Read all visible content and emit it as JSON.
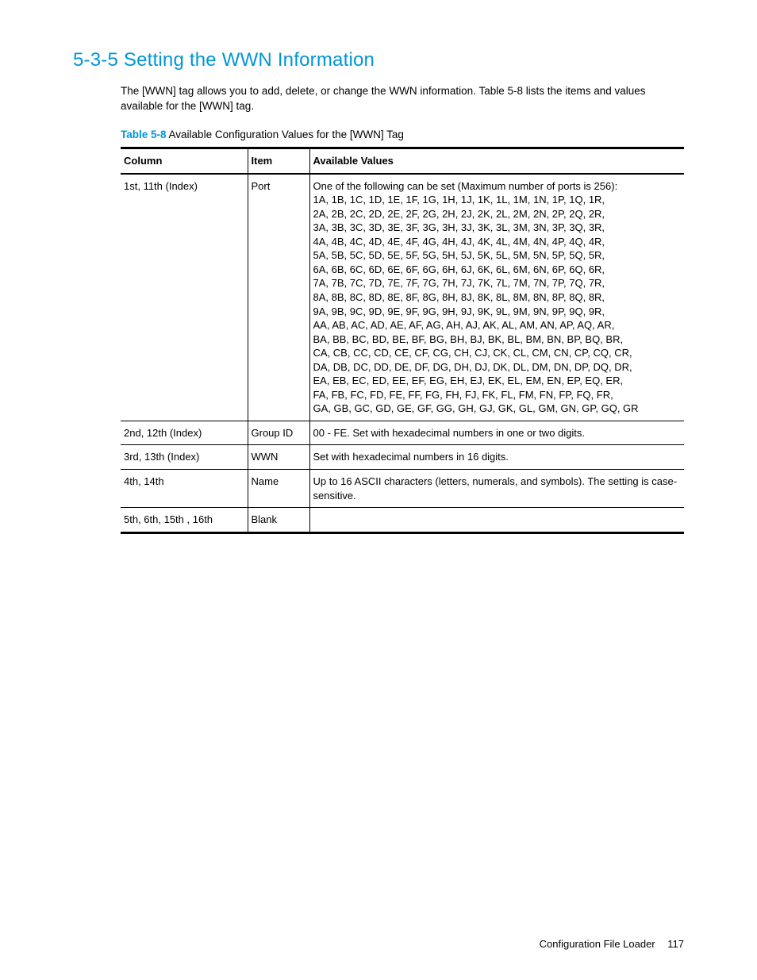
{
  "heading": "5-3-5 Setting the WWN Information",
  "intro": "The [WWN] tag allows you to add, delete, or change the WWN information. Table 5-8 lists the items and values available for the [WWN] tag.",
  "caption": {
    "label": "Table 5-8",
    "title": "  Available Configuration Values for the [WWN] Tag"
  },
  "headers": {
    "c1": "Column",
    "c2": "Item",
    "c3": "Available Values"
  },
  "rows": [
    {
      "column": "1st, 11th (Index)",
      "item": "Port",
      "values": "One of the following can be set (Maximum number of ports is 256):\n1A, 1B, 1C, 1D, 1E, 1F, 1G, 1H, 1J, 1K, 1L, 1M, 1N, 1P, 1Q, 1R,\n2A, 2B, 2C, 2D, 2E, 2F, 2G, 2H, 2J, 2K, 2L, 2M, 2N, 2P, 2Q, 2R,\n3A, 3B, 3C, 3D, 3E, 3F, 3G, 3H, 3J, 3K, 3L, 3M, 3N, 3P, 3Q, 3R,\n4A, 4B, 4C, 4D, 4E, 4F, 4G, 4H, 4J, 4K, 4L, 4M, 4N, 4P, 4Q, 4R,\n5A, 5B, 5C, 5D, 5E, 5F, 5G, 5H, 5J, 5K, 5L, 5M, 5N, 5P, 5Q, 5R,\n6A, 6B, 6C, 6D, 6E, 6F, 6G, 6H, 6J, 6K, 6L, 6M, 6N, 6P, 6Q, 6R,\n7A, 7B, 7C, 7D, 7E, 7F, 7G, 7H, 7J, 7K, 7L, 7M, 7N, 7P, 7Q, 7R,\n8A, 8B, 8C, 8D, 8E, 8F, 8G, 8H, 8J, 8K, 8L, 8M, 8N, 8P, 8Q, 8R,\n9A, 9B, 9C, 9D, 9E, 9F, 9G, 9H, 9J, 9K, 9L, 9M, 9N, 9P, 9Q, 9R,\nAA, AB, AC, AD, AE, AF, AG, AH, AJ, AK, AL, AM, AN, AP, AQ, AR,\nBA, BB, BC, BD, BE, BF, BG, BH, BJ, BK, BL, BM, BN, BP, BQ, BR,\nCA, CB, CC, CD, CE, CF, CG, CH, CJ, CK, CL, CM, CN, CP, CQ, CR,\nDA, DB, DC, DD, DE, DF, DG, DH, DJ, DK, DL, DM, DN, DP, DQ, DR,\nEA, EB, EC, ED, EE, EF, EG, EH, EJ, EK, EL, EM, EN, EP, EQ, ER,\nFA, FB, FC, FD, FE, FF, FG, FH, FJ, FK, FL, FM, FN, FP, FQ, FR,\nGA, GB, GC, GD, GE, GF, GG, GH, GJ, GK, GL, GM, GN, GP, GQ, GR"
    },
    {
      "column": "2nd, 12th (Index)",
      "item": "Group ID",
      "values": "00 - FE. Set with hexadecimal numbers in one or two digits."
    },
    {
      "column": "3rd, 13th (Index)",
      "item": "WWN",
      "values": "Set with hexadecimal numbers in 16 digits."
    },
    {
      "column": "4th, 14th",
      "item": "Name",
      "values": "Up to 16 ASCII characters (letters, numerals, and symbols). The setting is case-sensitive."
    },
    {
      "column": "5th, 6th, 15th , 16th",
      "item": "Blank",
      "values": ""
    }
  ],
  "footer": {
    "title": "Configuration File Loader",
    "page": "117"
  }
}
